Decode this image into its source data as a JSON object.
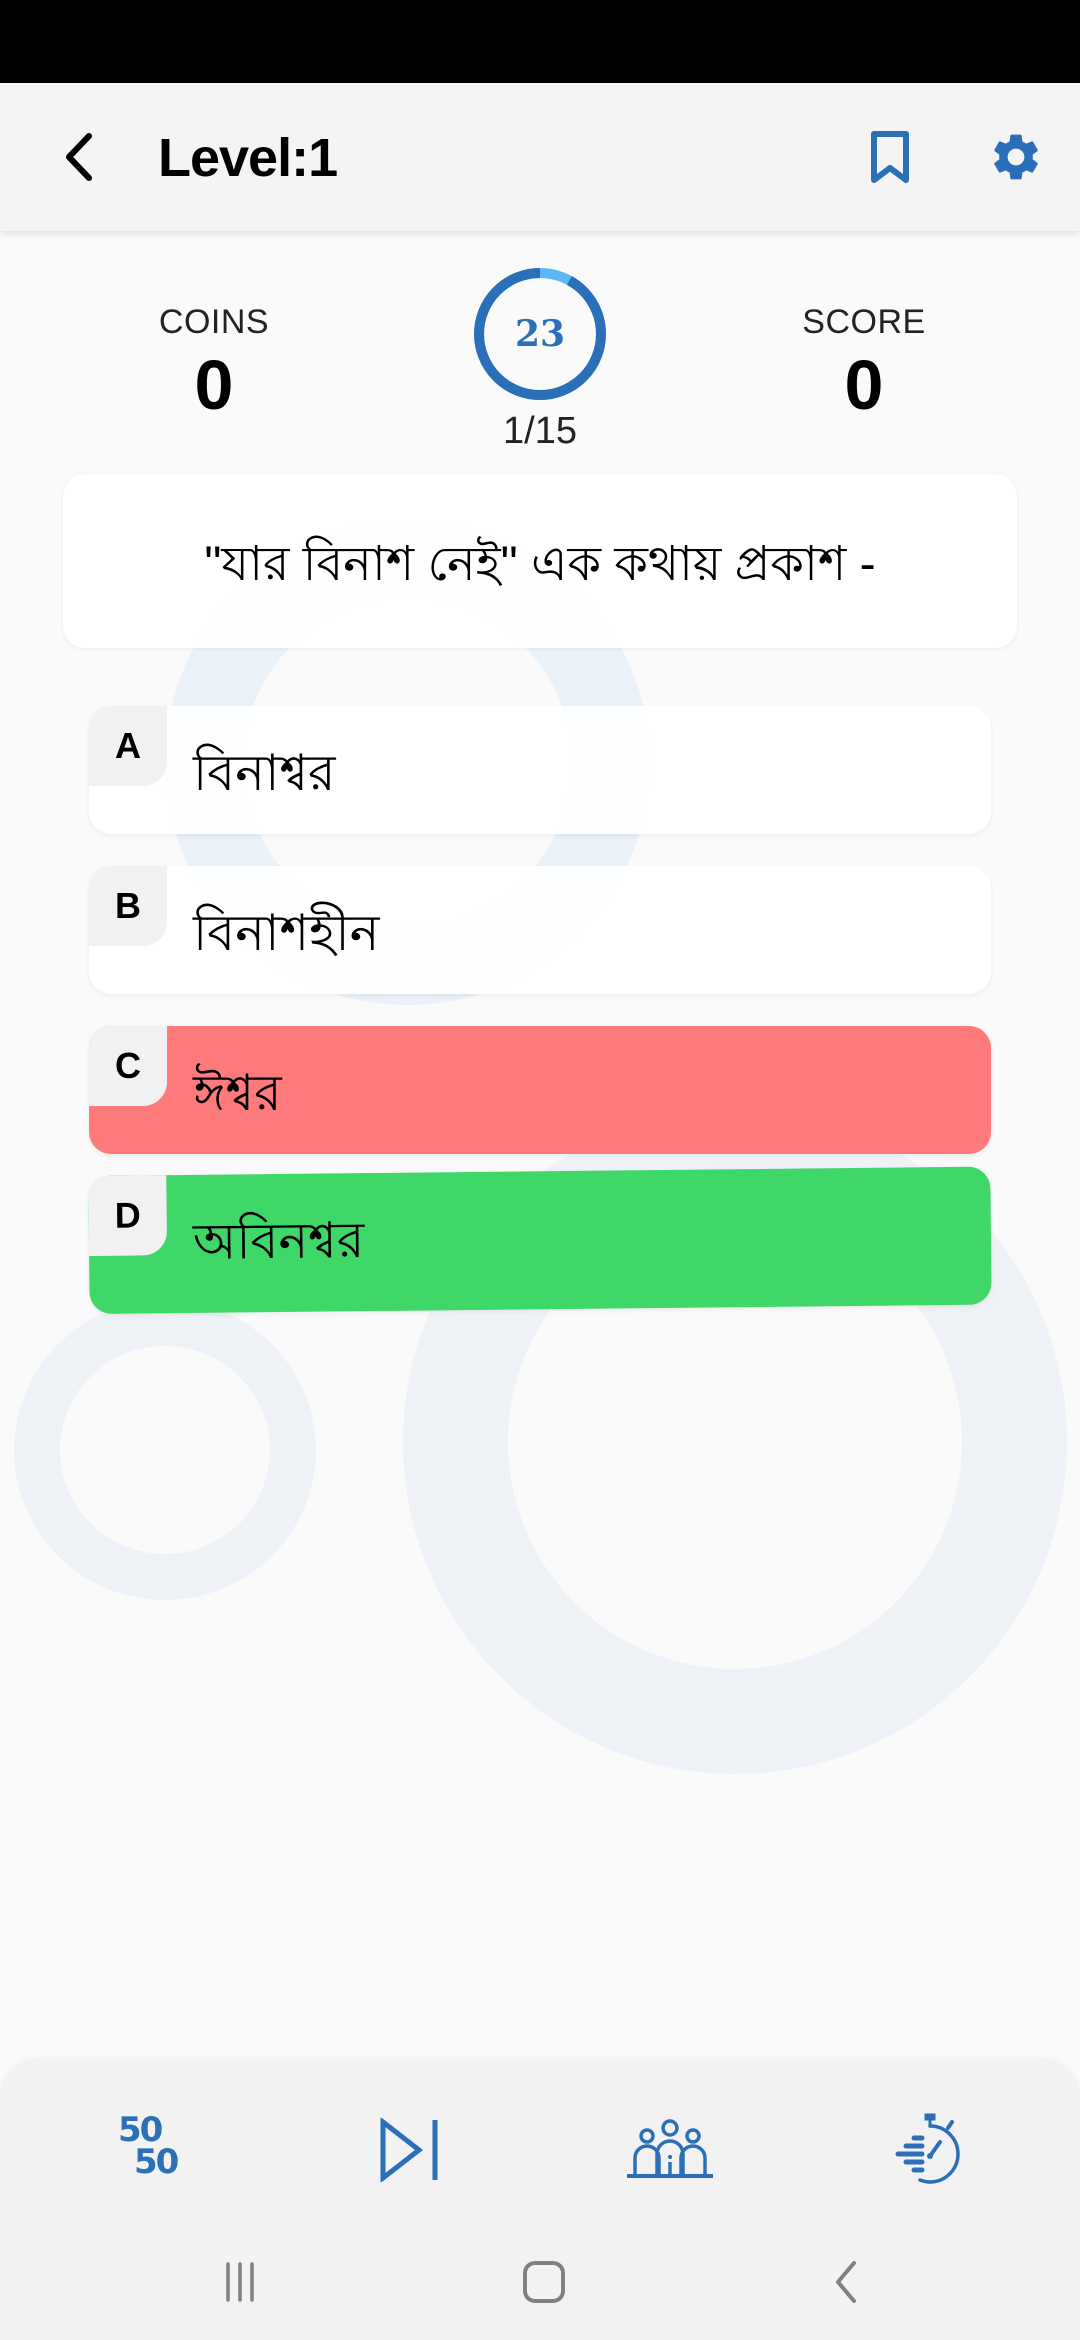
{
  "app_bar": {
    "title": "Level:1",
    "back_icon": "chevron-left-icon",
    "bookmark_icon": "bookmark-outline-icon",
    "settings_icon": "gear-icon"
  },
  "stats": {
    "coins_label": "COINS",
    "coins_value": "0",
    "score_label": "SCORE",
    "score_value": "0"
  },
  "timer": {
    "seconds_left": "23",
    "remaining_fraction": 0.92,
    "ring_color": "#2a6fb8",
    "elapsed_color": "#5ab8f5"
  },
  "progress": {
    "text": "1/15",
    "current": 1,
    "total": 15
  },
  "question": {
    "text": "\"যার বিনাশ নেই\" এক কথায় প্রকাশ -"
  },
  "options": [
    {
      "letter": "A",
      "text": "বিনাশ্বর",
      "state": "neutral"
    },
    {
      "letter": "B",
      "text": "বিনাশহীন",
      "state": "neutral"
    },
    {
      "letter": "C",
      "text": "ঈশ্বর",
      "state": "wrong",
      "color": "#ff7b7b"
    },
    {
      "letter": "D",
      "text": "অবিনশ্বর",
      "state": "correct",
      "color": "#3fd768"
    }
  ],
  "lifelines": [
    {
      "name": "fifty-fifty",
      "icon": "fifty-fifty-icon",
      "top": "50",
      "bottom": "50"
    },
    {
      "name": "skip-question",
      "icon": "skip-next-icon"
    },
    {
      "name": "audience-poll",
      "icon": "audience-icon"
    },
    {
      "name": "reset-timer",
      "icon": "stopwatch-icon"
    }
  ],
  "accent_color": "#2a6fb8",
  "system_nav": {
    "recent_icon": "recent-apps-icon",
    "home_icon": "home-icon",
    "back_icon": "back-icon"
  }
}
